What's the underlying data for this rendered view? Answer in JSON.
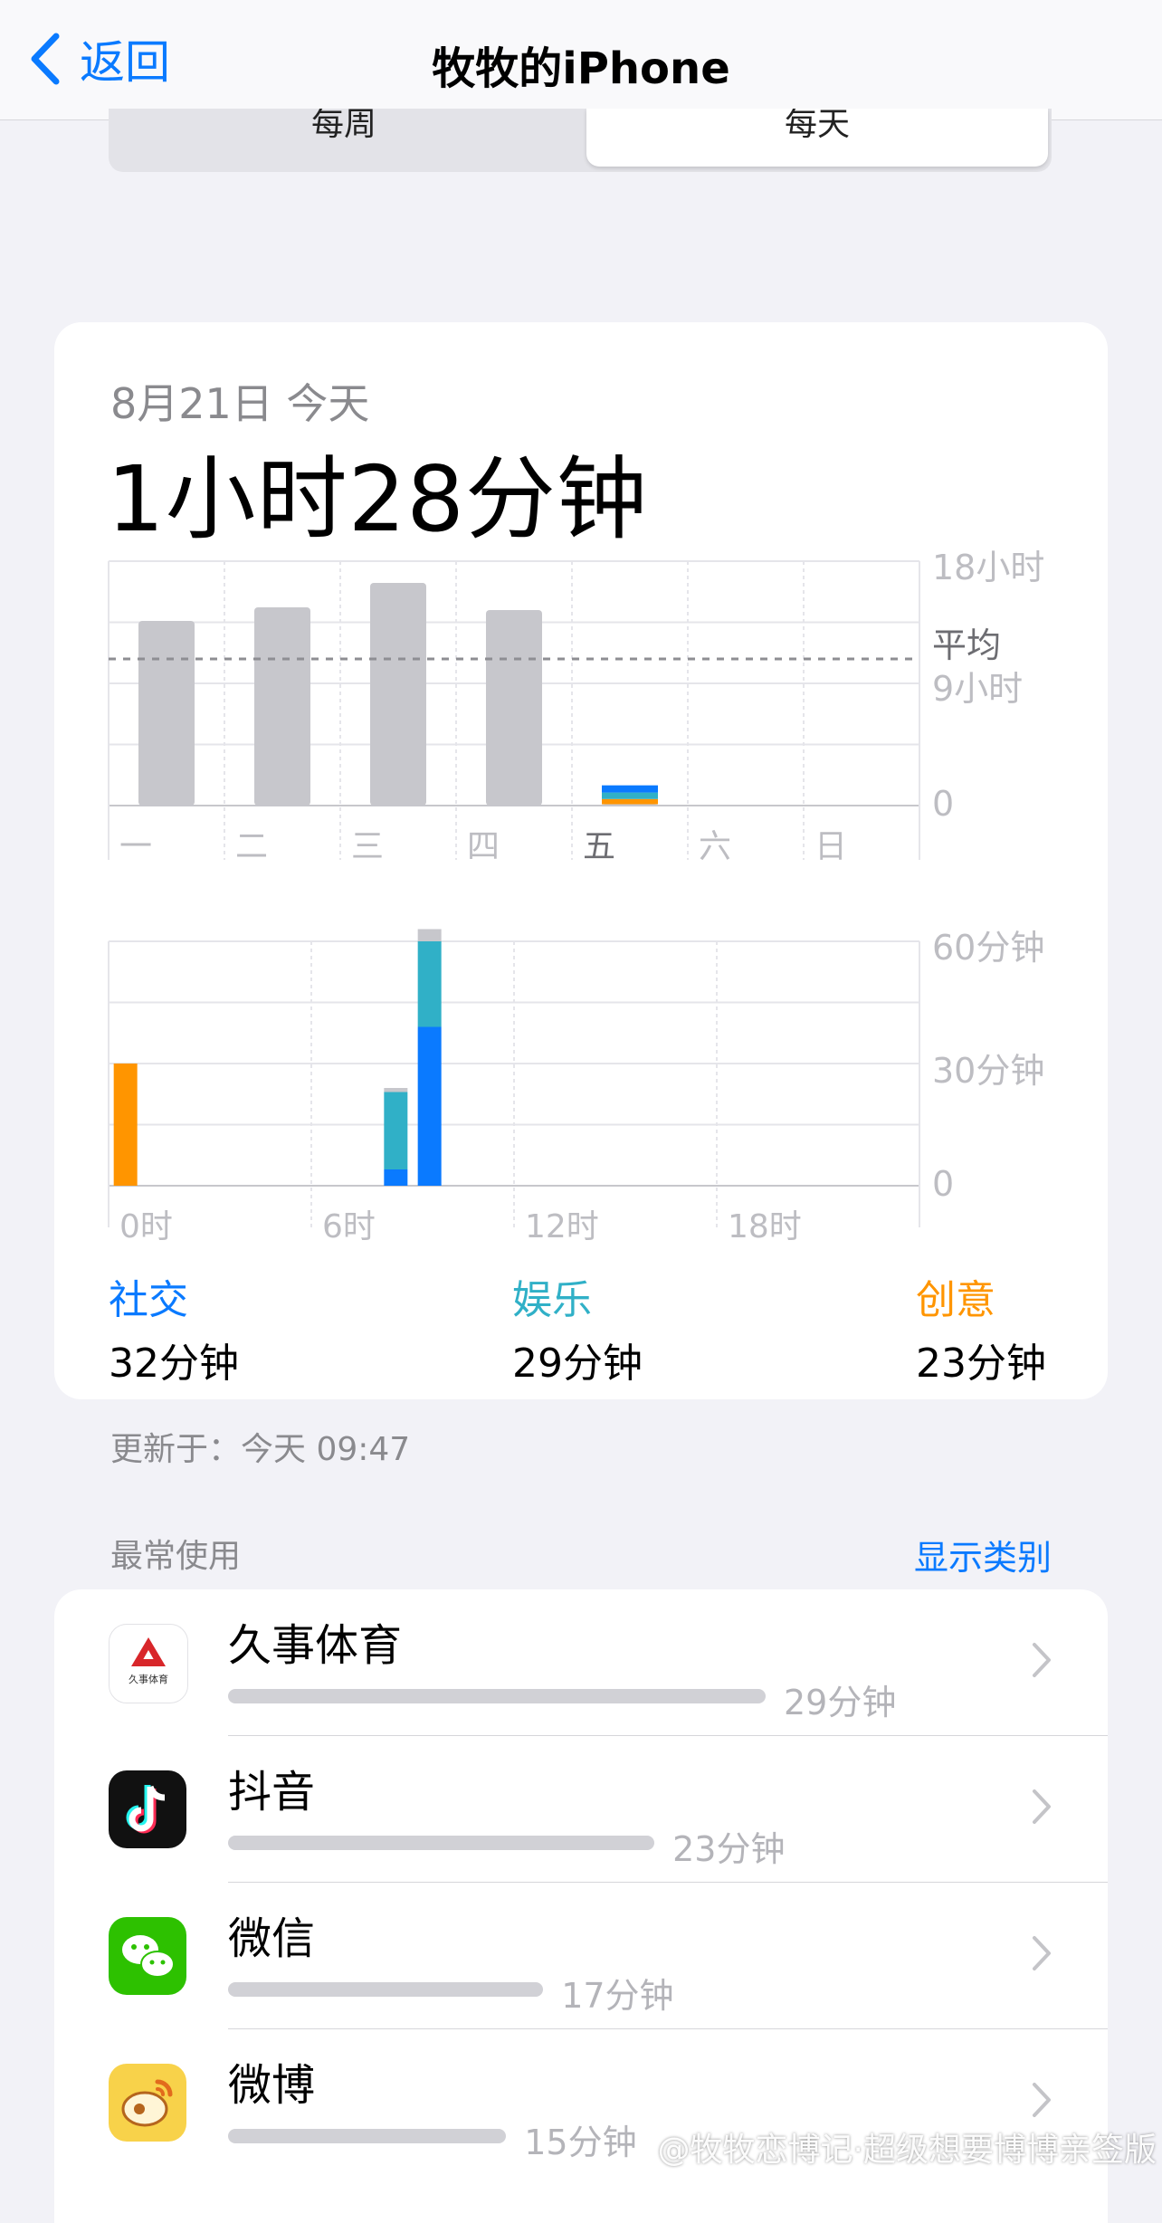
{
  "nav": {
    "back_label": "返回",
    "title": "牧牧的iPhone"
  },
  "segment": {
    "week_label": "每周",
    "day_label": "每天"
  },
  "summary": {
    "date_label": "8月21日 今天",
    "total_time": "1小时28分钟"
  },
  "colors": {
    "social": "#0a7aff",
    "entertainment": "#30b0c7",
    "creative": "#ff9500",
    "other": "#c7c7cc",
    "link": "#0a7aff"
  },
  "chart_data": [
    {
      "type": "bar",
      "categories": [
        "一",
        "二",
        "三",
        "四",
        "五",
        "六",
        "日"
      ],
      "y_tick_labels": [
        "18小时",
        "9小时",
        "0"
      ],
      "avg_label": "平均",
      "ylim": [
        0,
        18
      ],
      "average": 10.8,
      "series": [
        {
          "name": "社交",
          "values": [
            0,
            0,
            0,
            0,
            0.53,
            0,
            0
          ]
        },
        {
          "name": "娱乐",
          "values": [
            0,
            0,
            0,
            0,
            0.48,
            0,
            0
          ]
        },
        {
          "name": "创意",
          "values": [
            0,
            0,
            0,
            0,
            0.38,
            0,
            0
          ]
        },
        {
          "values": [
            13.6,
            14.6,
            16.4,
            14.4,
            0.1,
            0,
            0
          ]
        }
      ]
    },
    {
      "type": "bar",
      "x_tick_labels": [
        "0时",
        "6时",
        "12时",
        "18时"
      ],
      "y_tick_labels": [
        "60分钟",
        "30分钟",
        "0"
      ],
      "ylim": [
        0,
        60
      ],
      "x": [
        0,
        8,
        9
      ],
      "series": [
        {
          "name": "社交",
          "values": [
            0,
            4,
            39
          ]
        },
        {
          "name": "娱乐",
          "values": [
            0,
            19,
            21
          ]
        },
        {
          "name": "创意",
          "values": [
            30,
            0,
            0
          ]
        },
        {
          "values": [
            0,
            1,
            3
          ]
        }
      ]
    }
  ],
  "categories": [
    {
      "name": "社交",
      "value": "32分钟"
    },
    {
      "name": "娱乐",
      "value": "29分钟"
    },
    {
      "name": "创意",
      "value": "23分钟"
    }
  ],
  "updated": "更新于：今天 09:47",
  "most_used": {
    "title": "最常使用",
    "show_categories": "显示类别",
    "apps": [
      {
        "name": "久事体育",
        "duration": "29分钟",
        "minutes": 29,
        "icon": "jiushi-sports-icon",
        "logo_text": "久事体育"
      },
      {
        "name": "抖音",
        "duration": "23分钟",
        "minutes": 23,
        "icon": "douyin-icon"
      },
      {
        "name": "微信",
        "duration": "17分钟",
        "minutes": 17,
        "icon": "wechat-icon"
      },
      {
        "name": "微博",
        "duration": "15分钟",
        "minutes": 15,
        "icon": "weibo-icon"
      }
    ]
  },
  "watermark": "@牧牧恋博记·超级想要博博亲签版"
}
